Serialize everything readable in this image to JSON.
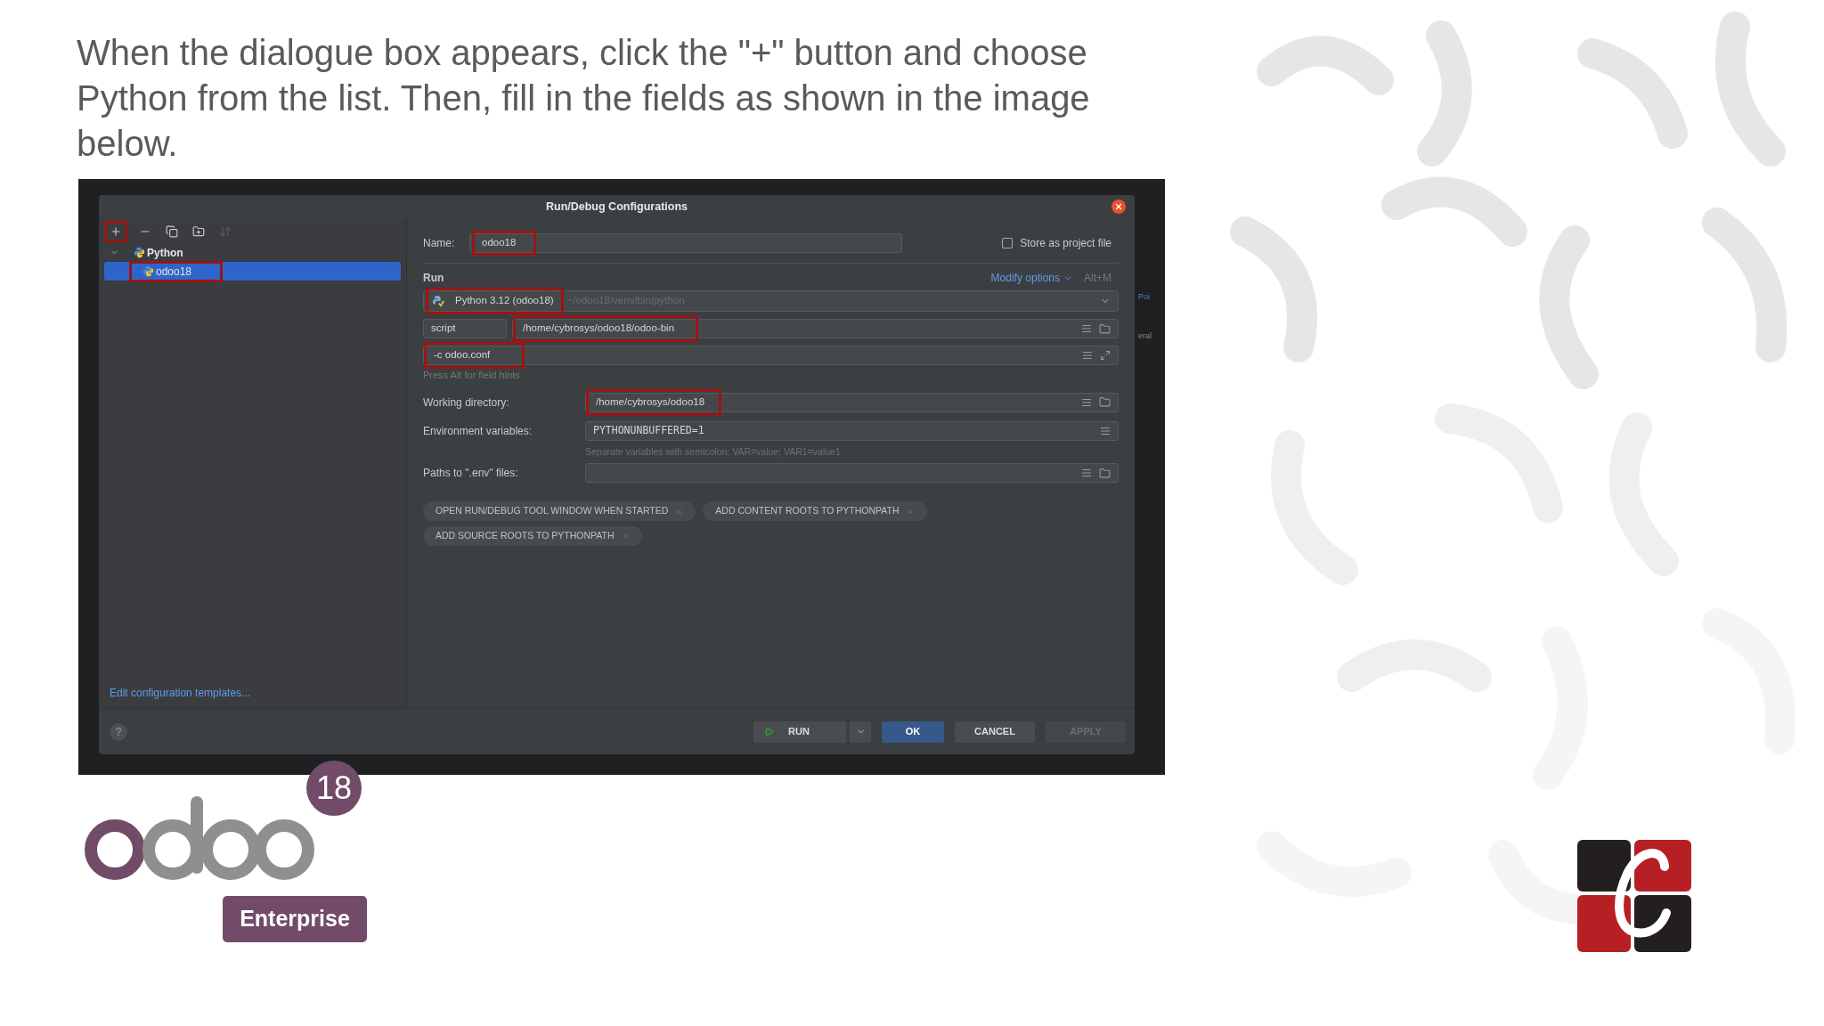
{
  "instruction": "When the dialogue box appears, click the \"+\" button and choose Python from the list. Then, fill in the fields as shown in the image below.",
  "screenshot": {
    "background_fragments": [
      "Poi",
      "eral"
    ],
    "dialog": {
      "title": "Run/Debug Configurations",
      "toolbar": [
        {
          "kind": "add",
          "highlighted": true,
          "disabled": false
        },
        {
          "kind": "remove",
          "disabled": false
        },
        {
          "kind": "copy",
          "disabled": false
        },
        {
          "kind": "folder",
          "disabled": false
        },
        {
          "kind": "sort",
          "disabled": true
        }
      ],
      "tree": [
        {
          "label": "Python",
          "expanded": true,
          "selected": false,
          "children": [
            {
              "label": "odoo18",
              "selected": true,
              "highlighted": true
            }
          ]
        }
      ],
      "templates_link": "Edit configuration templates...",
      "help": "?",
      "name": {
        "label": "Name:",
        "value": "odoo18",
        "highlighted": true
      },
      "store": {
        "label": "Store as project file",
        "checked": false
      },
      "run_heading": "Run",
      "modify_options": "Modify options",
      "modify_shortcut": "Alt+M",
      "interpreter": {
        "label": "Python 3.12 (odoo18)",
        "path": "~/odoo18/venv/bin/python",
        "highlighted": true
      },
      "script_type": "script",
      "script_path": {
        "value": "/home/cybrosys/odoo18/odoo-bin",
        "highlighted": true
      },
      "parameters": {
        "value": "-c odoo.conf",
        "highlighted": true
      },
      "hint": "Press Alt for field hints",
      "fields": [
        {
          "kind": "folder",
          "label": "Working directory:",
          "value": "/home/cybrosys/odoo18",
          "highlighted": true
        },
        {
          "kind": "env",
          "label": "Environment variables:",
          "value": "PYTHONUNBUFFERED=1",
          "note": "Separate variables with semicolon: VAR=value; VAR1=value1"
        },
        {
          "kind": "folder",
          "label": "Paths to \".env\" files:"
        }
      ],
      "chips": [
        "OPEN RUN/DEBUG TOOL WINDOW WHEN STARTED",
        "ADD CONTENT ROOTS TO PYTHONPATH",
        "ADD SOURCE ROOTS TO PYTHONPATH"
      ],
      "buttons": [
        {
          "kind": "run",
          "label": "RUN"
        },
        {
          "kind": "primary",
          "label": "OK"
        },
        {
          "kind": "normal",
          "label": "CANCEL",
          "disabled": false
        },
        {
          "kind": "normal",
          "label": "APPLY",
          "disabled": true
        }
      ]
    }
  },
  "logo": {
    "version": "18",
    "edition": "Enterprise"
  }
}
